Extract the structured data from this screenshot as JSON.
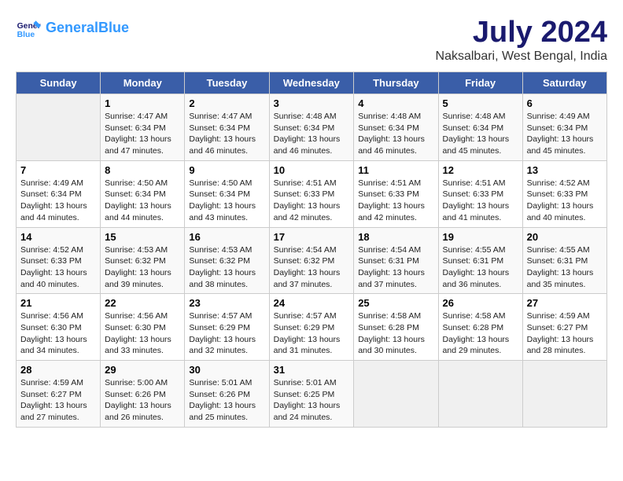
{
  "logo": {
    "line1": "General",
    "line2": "Blue"
  },
  "title": "July 2024",
  "location": "Naksalbari, West Bengal, India",
  "days_of_week": [
    "Sunday",
    "Monday",
    "Tuesday",
    "Wednesday",
    "Thursday",
    "Friday",
    "Saturday"
  ],
  "weeks": [
    [
      {
        "day": "",
        "sunrise": "",
        "sunset": "",
        "daylight": ""
      },
      {
        "day": "1",
        "sunrise": "Sunrise: 4:47 AM",
        "sunset": "Sunset: 6:34 PM",
        "daylight": "Daylight: 13 hours and 47 minutes."
      },
      {
        "day": "2",
        "sunrise": "Sunrise: 4:47 AM",
        "sunset": "Sunset: 6:34 PM",
        "daylight": "Daylight: 13 hours and 46 minutes."
      },
      {
        "day": "3",
        "sunrise": "Sunrise: 4:48 AM",
        "sunset": "Sunset: 6:34 PM",
        "daylight": "Daylight: 13 hours and 46 minutes."
      },
      {
        "day": "4",
        "sunrise": "Sunrise: 4:48 AM",
        "sunset": "Sunset: 6:34 PM",
        "daylight": "Daylight: 13 hours and 46 minutes."
      },
      {
        "day": "5",
        "sunrise": "Sunrise: 4:48 AM",
        "sunset": "Sunset: 6:34 PM",
        "daylight": "Daylight: 13 hours and 45 minutes."
      },
      {
        "day": "6",
        "sunrise": "Sunrise: 4:49 AM",
        "sunset": "Sunset: 6:34 PM",
        "daylight": "Daylight: 13 hours and 45 minutes."
      }
    ],
    [
      {
        "day": "7",
        "sunrise": "Sunrise: 4:49 AM",
        "sunset": "Sunset: 6:34 PM",
        "daylight": "Daylight: 13 hours and 44 minutes."
      },
      {
        "day": "8",
        "sunrise": "Sunrise: 4:50 AM",
        "sunset": "Sunset: 6:34 PM",
        "daylight": "Daylight: 13 hours and 44 minutes."
      },
      {
        "day": "9",
        "sunrise": "Sunrise: 4:50 AM",
        "sunset": "Sunset: 6:34 PM",
        "daylight": "Daylight: 13 hours and 43 minutes."
      },
      {
        "day": "10",
        "sunrise": "Sunrise: 4:51 AM",
        "sunset": "Sunset: 6:33 PM",
        "daylight": "Daylight: 13 hours and 42 minutes."
      },
      {
        "day": "11",
        "sunrise": "Sunrise: 4:51 AM",
        "sunset": "Sunset: 6:33 PM",
        "daylight": "Daylight: 13 hours and 42 minutes."
      },
      {
        "day": "12",
        "sunrise": "Sunrise: 4:51 AM",
        "sunset": "Sunset: 6:33 PM",
        "daylight": "Daylight: 13 hours and 41 minutes."
      },
      {
        "day": "13",
        "sunrise": "Sunrise: 4:52 AM",
        "sunset": "Sunset: 6:33 PM",
        "daylight": "Daylight: 13 hours and 40 minutes."
      }
    ],
    [
      {
        "day": "14",
        "sunrise": "Sunrise: 4:52 AM",
        "sunset": "Sunset: 6:33 PM",
        "daylight": "Daylight: 13 hours and 40 minutes."
      },
      {
        "day": "15",
        "sunrise": "Sunrise: 4:53 AM",
        "sunset": "Sunset: 6:32 PM",
        "daylight": "Daylight: 13 hours and 39 minutes."
      },
      {
        "day": "16",
        "sunrise": "Sunrise: 4:53 AM",
        "sunset": "Sunset: 6:32 PM",
        "daylight": "Daylight: 13 hours and 38 minutes."
      },
      {
        "day": "17",
        "sunrise": "Sunrise: 4:54 AM",
        "sunset": "Sunset: 6:32 PM",
        "daylight": "Daylight: 13 hours and 37 minutes."
      },
      {
        "day": "18",
        "sunrise": "Sunrise: 4:54 AM",
        "sunset": "Sunset: 6:31 PM",
        "daylight": "Daylight: 13 hours and 37 minutes."
      },
      {
        "day": "19",
        "sunrise": "Sunrise: 4:55 AM",
        "sunset": "Sunset: 6:31 PM",
        "daylight": "Daylight: 13 hours and 36 minutes."
      },
      {
        "day": "20",
        "sunrise": "Sunrise: 4:55 AM",
        "sunset": "Sunset: 6:31 PM",
        "daylight": "Daylight: 13 hours and 35 minutes."
      }
    ],
    [
      {
        "day": "21",
        "sunrise": "Sunrise: 4:56 AM",
        "sunset": "Sunset: 6:30 PM",
        "daylight": "Daylight: 13 hours and 34 minutes."
      },
      {
        "day": "22",
        "sunrise": "Sunrise: 4:56 AM",
        "sunset": "Sunset: 6:30 PM",
        "daylight": "Daylight: 13 hours and 33 minutes."
      },
      {
        "day": "23",
        "sunrise": "Sunrise: 4:57 AM",
        "sunset": "Sunset: 6:29 PM",
        "daylight": "Daylight: 13 hours and 32 minutes."
      },
      {
        "day": "24",
        "sunrise": "Sunrise: 4:57 AM",
        "sunset": "Sunset: 6:29 PM",
        "daylight": "Daylight: 13 hours and 31 minutes."
      },
      {
        "day": "25",
        "sunrise": "Sunrise: 4:58 AM",
        "sunset": "Sunset: 6:28 PM",
        "daylight": "Daylight: 13 hours and 30 minutes."
      },
      {
        "day": "26",
        "sunrise": "Sunrise: 4:58 AM",
        "sunset": "Sunset: 6:28 PM",
        "daylight": "Daylight: 13 hours and 29 minutes."
      },
      {
        "day": "27",
        "sunrise": "Sunrise: 4:59 AM",
        "sunset": "Sunset: 6:27 PM",
        "daylight": "Daylight: 13 hours and 28 minutes."
      }
    ],
    [
      {
        "day": "28",
        "sunrise": "Sunrise: 4:59 AM",
        "sunset": "Sunset: 6:27 PM",
        "daylight": "Daylight: 13 hours and 27 minutes."
      },
      {
        "day": "29",
        "sunrise": "Sunrise: 5:00 AM",
        "sunset": "Sunset: 6:26 PM",
        "daylight": "Daylight: 13 hours and 26 minutes."
      },
      {
        "day": "30",
        "sunrise": "Sunrise: 5:01 AM",
        "sunset": "Sunset: 6:26 PM",
        "daylight": "Daylight: 13 hours and 25 minutes."
      },
      {
        "day": "31",
        "sunrise": "Sunrise: 5:01 AM",
        "sunset": "Sunset: 6:25 PM",
        "daylight": "Daylight: 13 hours and 24 minutes."
      },
      {
        "day": "",
        "sunrise": "",
        "sunset": "",
        "daylight": ""
      },
      {
        "day": "",
        "sunrise": "",
        "sunset": "",
        "daylight": ""
      },
      {
        "day": "",
        "sunrise": "",
        "sunset": "",
        "daylight": ""
      }
    ]
  ]
}
